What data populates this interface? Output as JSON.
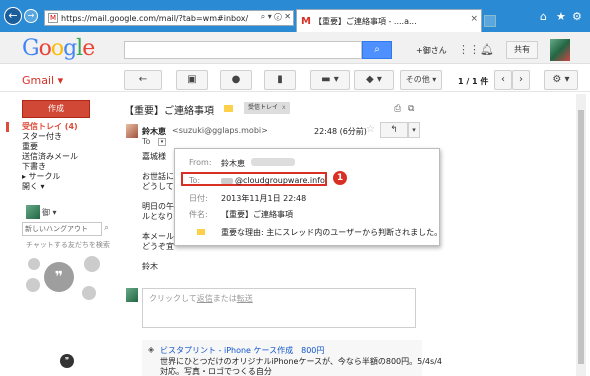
{
  "browser": {
    "url": "https://mail.google.com/mail/?tab=wm#inbox/14213e",
    "tab_title": "【重要】ご連絡事項 - ....a...",
    "addr_icons": "⌕ ▾ ⓒ ✕",
    "back_icon": "back-arrow-icon",
    "forward_icon": "forward-arrow-icon"
  },
  "header": {
    "logo_letters": [
      "G",
      "o",
      "o",
      "g",
      "l",
      "e"
    ],
    "logo_colors": [
      "#4285f4",
      "#ea4335",
      "#fbbc05",
      "#4285f4",
      "#34a853",
      "#ea4335"
    ],
    "search_placeholder": "",
    "user_name": "+御さん",
    "share_label": "共有"
  },
  "toolbar": {
    "gmail_label": "Gmail ▾",
    "more_label": "その他 ▾",
    "pager": "1 / 1 件"
  },
  "sidebar": {
    "compose_label": "作成",
    "items": [
      {
        "label": "受信トレイ (4)",
        "active": true
      },
      {
        "label": "スター付き"
      },
      {
        "label": "重要"
      },
      {
        "label": "送信済みメール"
      },
      {
        "label": "下書き"
      },
      {
        "label": "▸ サークル"
      },
      {
        "label": "開く ▾"
      }
    ],
    "chat_name": "御 ▾",
    "hangout_placeholder": "新しいハングアウト",
    "chat_hint": "チャットする友だちを検索",
    "hangouts_glyph": "❞",
    "bottom_glyph": "❞"
  },
  "message": {
    "subject": "【重要】ご連絡事項",
    "label_chip": "受信トレイ",
    "label_chip_x": "x",
    "sender_name": "鈴木恵",
    "sender_email": "<suzuki@gglaps.mobi>",
    "date": "22:48 (6分前)",
    "to_line": "To",
    "body_lines": [
      "嘉城様",
      "",
      "お世話に",
      "どうして",
      "",
      "明日の午",
      "ルとなり",
      "",
      "本メール",
      "どうぞ宜",
      "",
      "鈴木"
    ]
  },
  "popup": {
    "from_label": "From:",
    "from_value": "鈴木恵",
    "to_label": "To:",
    "to_value": "@cloudgroupware.info",
    "date_label": "日付:",
    "date_value": "2013年11月1日 22:48",
    "subject_label": "件名:",
    "subject_value": "【重要】ご連絡事項",
    "importance_value": "重要な理由: 主にスレッド内のユーザーから判断されました。",
    "badge": "1"
  },
  "reply": {
    "prefix": "クリックして",
    "reply_link": "返信",
    "middle": "または",
    "forward_link": "転送"
  },
  "ad": {
    "title": "ビスタプリント - iPhone ケース作成　800円",
    "line1": "世界にひとつだけのオリジナルiPhoneケースが、今なら半額の800円。5/4s/4",
    "line2": "対応。写真・ロゴでつくる自分"
  }
}
